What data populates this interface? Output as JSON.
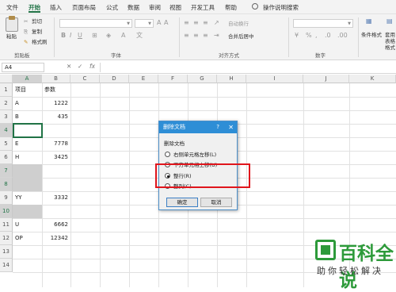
{
  "ribbon_tabs": [
    "文件",
    "开始",
    "插入",
    "页面布局",
    "公式",
    "数据",
    "审阅",
    "视图",
    "开发工具",
    "帮助"
  ],
  "active_tab": "开始",
  "tell_me": "操作说明搜索",
  "clipboard": {
    "paste": "粘贴",
    "cut": "剪切",
    "copy": "复制",
    "format_painter": "格式刷",
    "group": "剪贴板"
  },
  "ribbon_groups": {
    "font": "字体",
    "alignment": "对齐方式",
    "number": "数字"
  },
  "alignment": {
    "wrap": "自动换行",
    "merge": "合并后居中"
  },
  "styles": {
    "conditional": "条件格式",
    "table": "套用表格格式"
  },
  "formula_bar": {
    "name_box": "A4",
    "fx": "fx"
  },
  "columns": [
    "A",
    "B",
    "C",
    "D",
    "E",
    "F",
    "G",
    "H",
    "I",
    "J",
    "K"
  ],
  "rows": [
    "1",
    "2",
    "3",
    "4",
    "5",
    "6",
    "7",
    "8",
    "9",
    "10",
    "11",
    "12",
    "13",
    "14"
  ],
  "cells": {
    "r1": {
      "a": "项目",
      "b": "参数"
    },
    "r2": {
      "a": "A",
      "b": "1222"
    },
    "r3": {
      "a": "B",
      "b": "435"
    },
    "r5": {
      "a": "E",
      "b": "7778"
    },
    "r6": {
      "a": "H",
      "b": "3425"
    },
    "r9": {
      "a": "YY",
      "b": "3332"
    },
    "r11": {
      "a": "U",
      "b": "6662"
    },
    "r12": {
      "a": "OP",
      "b": "12342"
    }
  },
  "dialog": {
    "title": "删除文档",
    "help": "?",
    "close": "✕",
    "section": "删除文档",
    "options": [
      {
        "label": "右侧单元格左移(L)",
        "selected": false
      },
      {
        "label": "下方单元格上移(U)",
        "selected": false
      },
      {
        "label": "整行(R)",
        "selected": true
      },
      {
        "label": "整列(C)",
        "selected": false
      }
    ],
    "ok": "确定",
    "cancel": "取消"
  },
  "watermark": {
    "title": "百科全说",
    "subtitle": "助你轻松解决"
  },
  "colors": {
    "excel_green": "#217346",
    "dialog_blue": "#2e8ed6",
    "highlight_red": "#e0151c",
    "watermark_green": "#2d9a3a"
  }
}
